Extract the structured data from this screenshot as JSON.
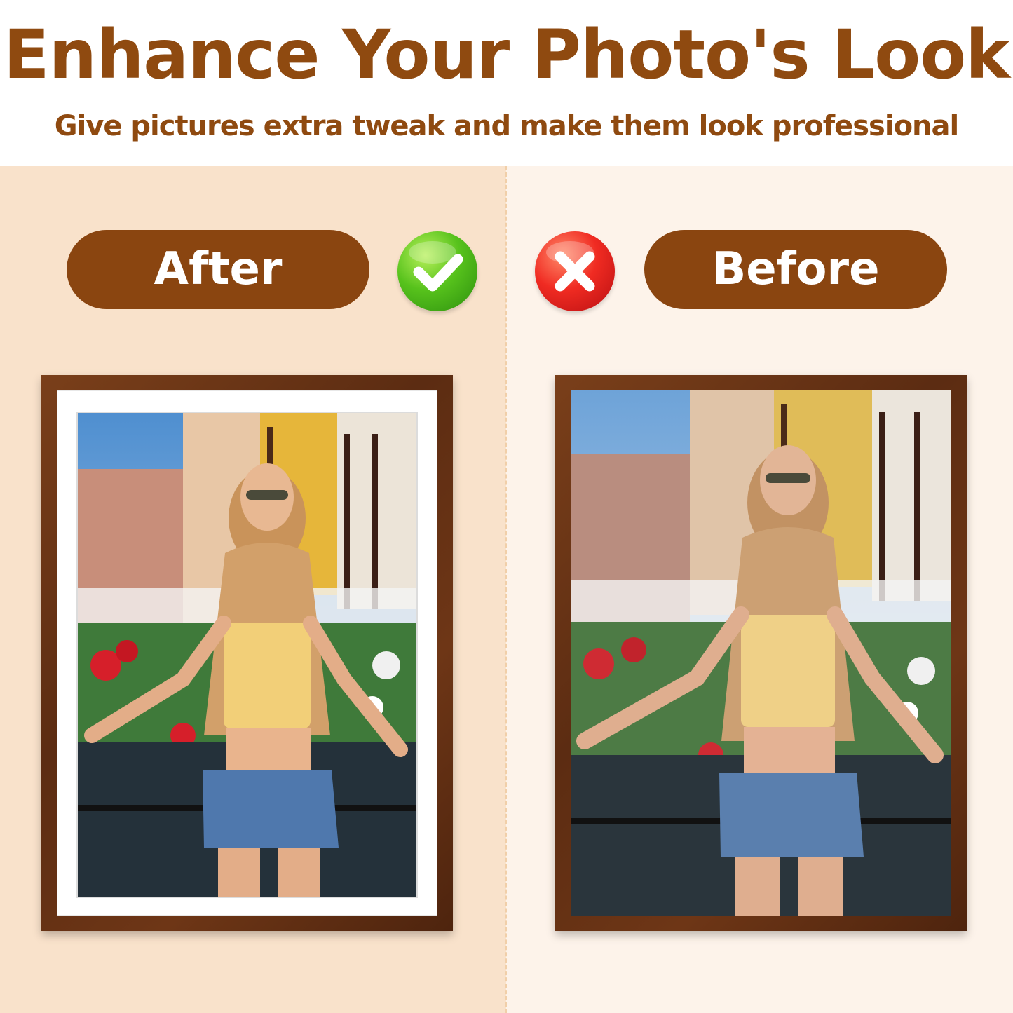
{
  "header": {
    "title": "Enhance Your Photo's Look",
    "subtitle": "Give pictures extra tweak and make them look professional"
  },
  "after_panel": {
    "label": "After",
    "badge_icon": "check-icon",
    "frame_style": "dark walnut frame with white mat"
  },
  "before_panel": {
    "label": "Before",
    "badge_icon": "cross-icon"
  },
  "colors": {
    "brand_brown": "#8a4510",
    "title_brown": "#8f4a10",
    "left_bg": "#f9e2cb",
    "right_bg": "#fdf3ea",
    "check_green": "#57c21c",
    "cross_red": "#f02b22"
  }
}
